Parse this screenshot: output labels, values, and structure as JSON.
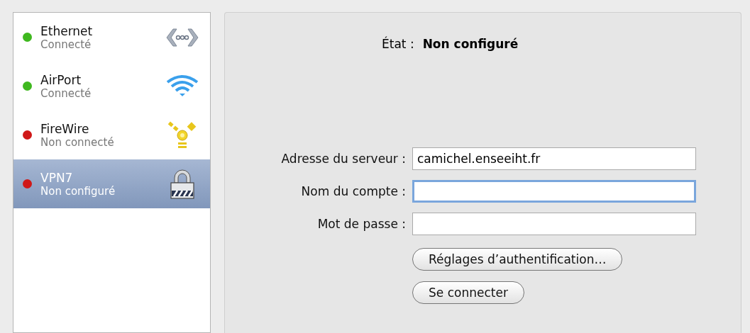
{
  "services": [
    {
      "name": "Ethernet",
      "status": "Connecté",
      "color": "#3fb81f",
      "kind": "ethernet",
      "selected": false
    },
    {
      "name": "AirPort",
      "status": "Connecté",
      "color": "#3fb81f",
      "kind": "wifi",
      "selected": false
    },
    {
      "name": "FireWire",
      "status": "Non connecté",
      "color": "#d01818",
      "kind": "firewire",
      "selected": false
    },
    {
      "name": "VPN7",
      "status": "Non configuré",
      "color": "#d01818",
      "kind": "vpn",
      "selected": true
    }
  ],
  "state": {
    "label": "État :",
    "value": "Non configuré"
  },
  "fields": [
    {
      "label": "Adresse du serveur :",
      "value": "camichel.enseeiht.fr",
      "focused": false
    },
    {
      "label": "Nom du compte :",
      "focused": true
    },
    {
      "label": "Mot de passe :",
      "focused": false
    }
  ],
  "buttons": [
    "Réglages d’authentification…",
    "Se connecter"
  ]
}
